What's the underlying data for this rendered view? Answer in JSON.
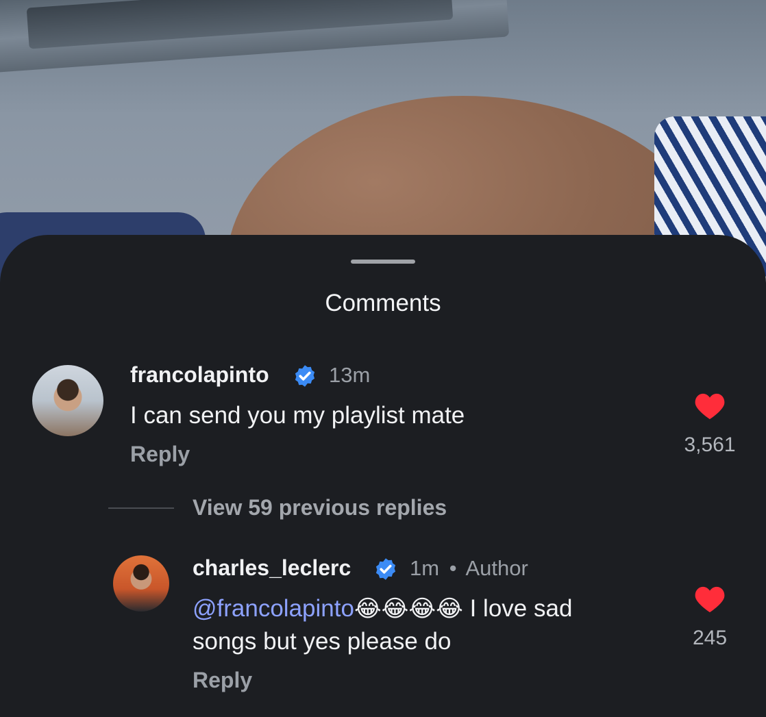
{
  "sheet": {
    "title": "Comments"
  },
  "comments": [
    {
      "username": "francolapinto",
      "time": "13m",
      "text": "I can send you my playlist mate",
      "reply_label": "Reply",
      "likes": "3,561"
    }
  ],
  "view_replies": "View 59 previous replies",
  "replies": [
    {
      "username": "charles_leclerc",
      "time": "1m",
      "separator": "•",
      "author_tag": "Author",
      "mention": "@francolapinto",
      "emojis": "😂😂😂😂",
      "text_after": " I love sad",
      "text_line2": "songs but yes please do",
      "reply_label": "Reply",
      "likes": "245"
    }
  ],
  "icons": {
    "verified": "verified-badge-icon",
    "heart": "heart-filled-icon"
  },
  "colors": {
    "background": "#1c1e22",
    "verified_blue": "#3b8bf5",
    "heart_red": "#ff2d3a",
    "mention": "#8da2ff"
  }
}
